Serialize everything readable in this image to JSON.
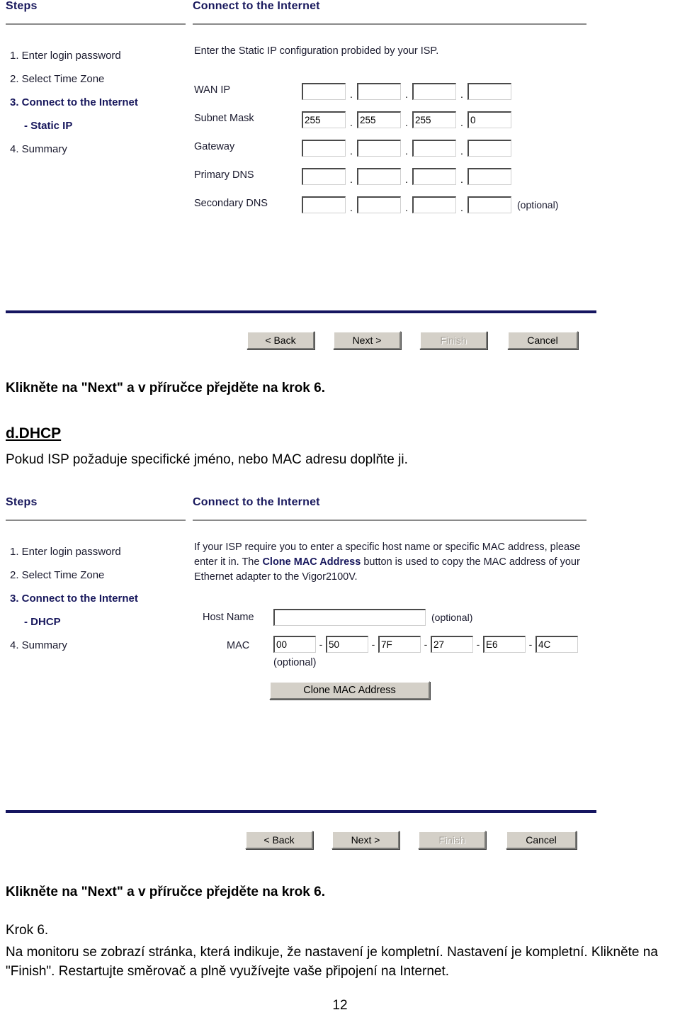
{
  "page": {
    "number": "12"
  },
  "wizard_static": {
    "steps_heading": "Steps",
    "panel_title": "Connect to the Internet",
    "steps": [
      {
        "label": "1. Enter login password",
        "style": "normal"
      },
      {
        "label": "2. Select Time Zone",
        "style": "normal"
      },
      {
        "label": "3. Connect to the Internet",
        "style": "bold"
      },
      {
        "label": "- Static IP",
        "style": "sub"
      },
      {
        "label": "4. Summary",
        "style": "normal"
      }
    ],
    "description": "Enter the Static IP configuration probided by your ISP.",
    "fields": [
      {
        "label": "WAN IP",
        "octets": [
          "",
          "",
          "",
          ""
        ],
        "note": ""
      },
      {
        "label": "Subnet Mask",
        "octets": [
          "255",
          "255",
          "255",
          "0"
        ],
        "note": ""
      },
      {
        "label": "Gateway",
        "octets": [
          "",
          "",
          "",
          ""
        ],
        "note": ""
      },
      {
        "label": "Primary DNS",
        "octets": [
          "",
          "",
          "",
          ""
        ],
        "note": ""
      },
      {
        "label": "Secondary DNS",
        "octets": [
          "",
          "",
          "",
          ""
        ],
        "note": "(optional)"
      }
    ],
    "buttons": {
      "back": "< Back",
      "next": "Next >",
      "finish": "Finish",
      "cancel": "Cancel"
    }
  },
  "wizard_dhcp": {
    "steps_heading": "Steps",
    "panel_title": "Connect to the Internet",
    "steps": [
      {
        "label": "1. Enter login password",
        "style": "normal"
      },
      {
        "label": "2. Select Time Zone",
        "style": "normal"
      },
      {
        "label": "3. Connect to the Internet",
        "style": "bold"
      },
      {
        "label": "- DHCP",
        "style": "sub"
      },
      {
        "label": "4. Summary",
        "style": "normal"
      }
    ],
    "description_part1": "If your ISP require you to enter a specific host name or specific MAC address, please enter it in. The ",
    "description_emphasis": "Clone MAC Address",
    "description_part2": " button is used to copy the MAC address of your Ethernet adapter to the Vigor2100V.",
    "host_name_label": "Host Name",
    "host_name_value": "",
    "host_name_note": "(optional)",
    "mac_label": "MAC",
    "mac_octets": [
      "00",
      "50",
      "7F",
      "27",
      "E6",
      "4C"
    ],
    "mac_note": "(optional)",
    "clone_button": "Clone MAC Address",
    "buttons": {
      "back": "< Back",
      "next": "Next >",
      "finish": "Finish",
      "cancel": "Cancel"
    }
  },
  "prose": {
    "line_after_static": "Klikněte na \"Next\" a v příručce přejděte na krok 6.",
    "dhcp_heading": "d.DHCP",
    "dhcp_intro": "Pokud ISP požaduje specifické jméno, nebo MAC adresu doplňte ji.",
    "line_after_dhcp": "Klikněte na \"Next\" a v příručce přejděte na krok 6.",
    "step6_heading": "Krok 6.",
    "step6_body": "Na monitoru se zobrazí stránka, která indikuje, že nastavení je kompletní. Nastavení je kompletní. Klikněte na \"Finish\". Restartujte směrovač a plně využívejte vaše připojení na Internet."
  }
}
